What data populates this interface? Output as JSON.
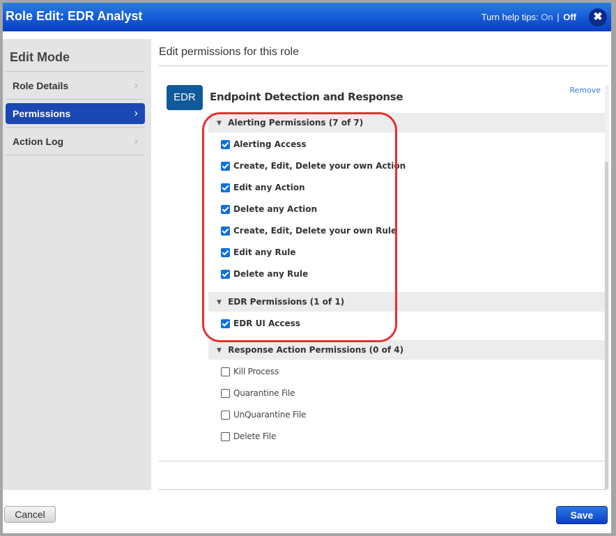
{
  "window": {
    "title": "Role Edit: EDR Analyst",
    "help_tips_label": "Turn help tips:",
    "help_on": "On",
    "help_separator": "|",
    "help_off": "Off",
    "close_icon": "✖"
  },
  "sidebar": {
    "title": "Edit Mode",
    "items": [
      {
        "label": "Role Details",
        "active": false
      },
      {
        "label": "Permissions",
        "active": true
      },
      {
        "label": "Action Log",
        "active": false
      }
    ],
    "chevron_icon": "›"
  },
  "main": {
    "heading": "Edit permissions for this role",
    "module": {
      "badge": "EDR",
      "title": "Endpoint Detection and Response",
      "remove_label": "Remove"
    },
    "groups": [
      {
        "label": "Alerting Permissions (7 of 7)",
        "items": [
          {
            "label": "Alerting Access",
            "checked": true
          },
          {
            "label": "Create, Edit, Delete your own Action",
            "checked": true
          },
          {
            "label": "Edit any Action",
            "checked": true
          },
          {
            "label": "Delete any Action",
            "checked": true
          },
          {
            "label": "Create, Edit, Delete your own Rule",
            "checked": true
          },
          {
            "label": "Edit any Rule",
            "checked": true
          },
          {
            "label": "Delete any Rule",
            "checked": true
          }
        ]
      },
      {
        "label": "EDR Permissions (1 of 1)",
        "items": [
          {
            "label": "EDR UI Access",
            "checked": true
          }
        ]
      },
      {
        "label": "Response Action Permissions (0 of 4)",
        "items": [
          {
            "label": "Kill Process",
            "checked": false
          },
          {
            "label": "Quarantine File",
            "checked": false
          },
          {
            "label": "UnQuarantine File",
            "checked": false
          },
          {
            "label": "Delete File",
            "checked": false
          }
        ]
      }
    ],
    "collapse_icon": "▼"
  },
  "footer": {
    "cancel_label": "Cancel",
    "save_label": "Save"
  },
  "colors": {
    "titlebar": "#1559d6",
    "active_nav": "#1b47b4",
    "badge": "#10599b",
    "checkbox": "#0f6fe0",
    "highlight": "#e53030",
    "link": "#3a7bd5"
  }
}
